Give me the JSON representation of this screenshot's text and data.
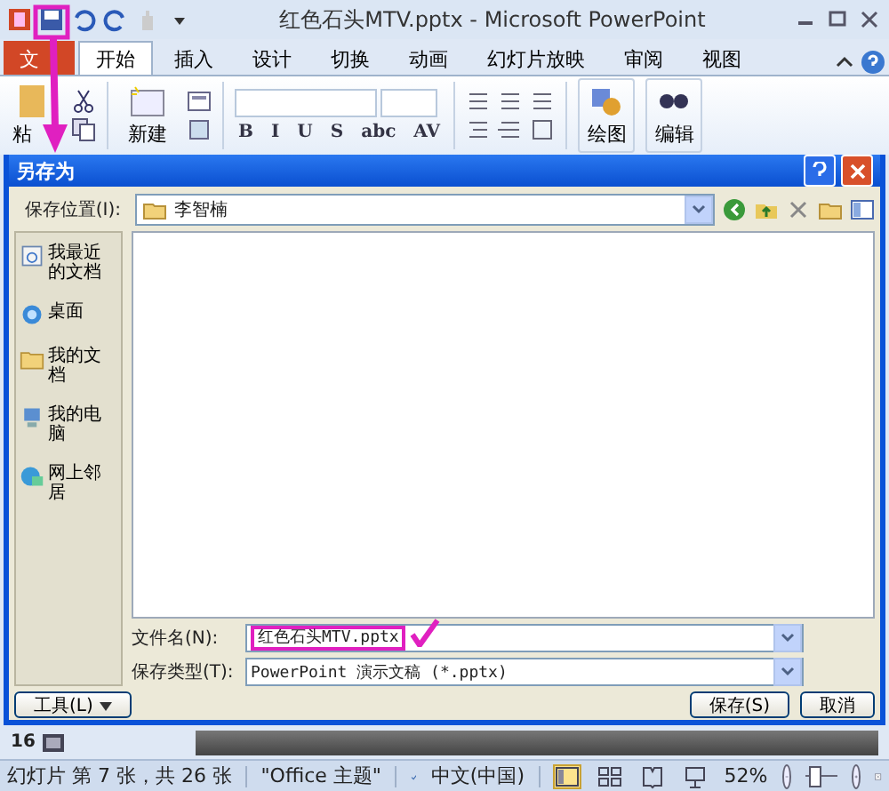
{
  "window": {
    "title": "红色石头MTV.pptx - Microsoft PowerPoint"
  },
  "ribbon_tabs": [
    {
      "label": "文",
      "kind": "file",
      "selected": false
    },
    {
      "label": "开始",
      "kind": "tab",
      "selected": true
    },
    {
      "label": "插入",
      "kind": "tab",
      "selected": false
    },
    {
      "label": "设计",
      "kind": "tab",
      "selected": false
    },
    {
      "label": "切换",
      "kind": "tab",
      "selected": false
    },
    {
      "label": "动画",
      "kind": "tab",
      "selected": false
    },
    {
      "label": "幻灯片放映",
      "kind": "tab",
      "selected": false
    },
    {
      "label": "审阅",
      "kind": "tab",
      "selected": false
    },
    {
      "label": "视图",
      "kind": "tab",
      "selected": false
    }
  ],
  "ribbon": {
    "paste": "粘",
    "new_slide": "新建",
    "format_buttons": [
      "B",
      "I",
      "U",
      "S",
      "abc",
      "AV"
    ],
    "drawing": "绘图",
    "editing": "编辑"
  },
  "dialog": {
    "title": "另存为",
    "save_in_label": "保存位置(I):",
    "save_in_value": "李智楠",
    "places": [
      {
        "label": "我最近的文档",
        "kind": "recent"
      },
      {
        "label": "桌面",
        "kind": "desktop"
      },
      {
        "label": "我的文档",
        "kind": "documents"
      },
      {
        "label": "我的电脑",
        "kind": "computer"
      },
      {
        "label": "网上邻居",
        "kind": "network"
      }
    ],
    "file_name_label": "文件名(N):",
    "file_name": "红色石头MTV.pptx",
    "file_type_label": "保存类型(T):",
    "file_type": "PowerPoint 演示文稿 (*.pptx)",
    "tools_button": "工具(L)",
    "save_button": "保存(S)",
    "cancel_button": "取消"
  },
  "slide_panel": {
    "slide_number": "16"
  },
  "status_bar": {
    "slide_info": "幻灯片 第 7 张，共 26 张",
    "theme": "\"Office 主题\"",
    "language": "中文(中国)",
    "view_buttons": [
      {
        "kind": "normal",
        "selected": true
      },
      {
        "kind": "sorter",
        "selected": false
      },
      {
        "kind": "reading",
        "selected": false
      },
      {
        "kind": "show",
        "selected": false
      }
    ],
    "zoom": "52%",
    "zoom_slider": {
      "level": 0.3
    }
  }
}
